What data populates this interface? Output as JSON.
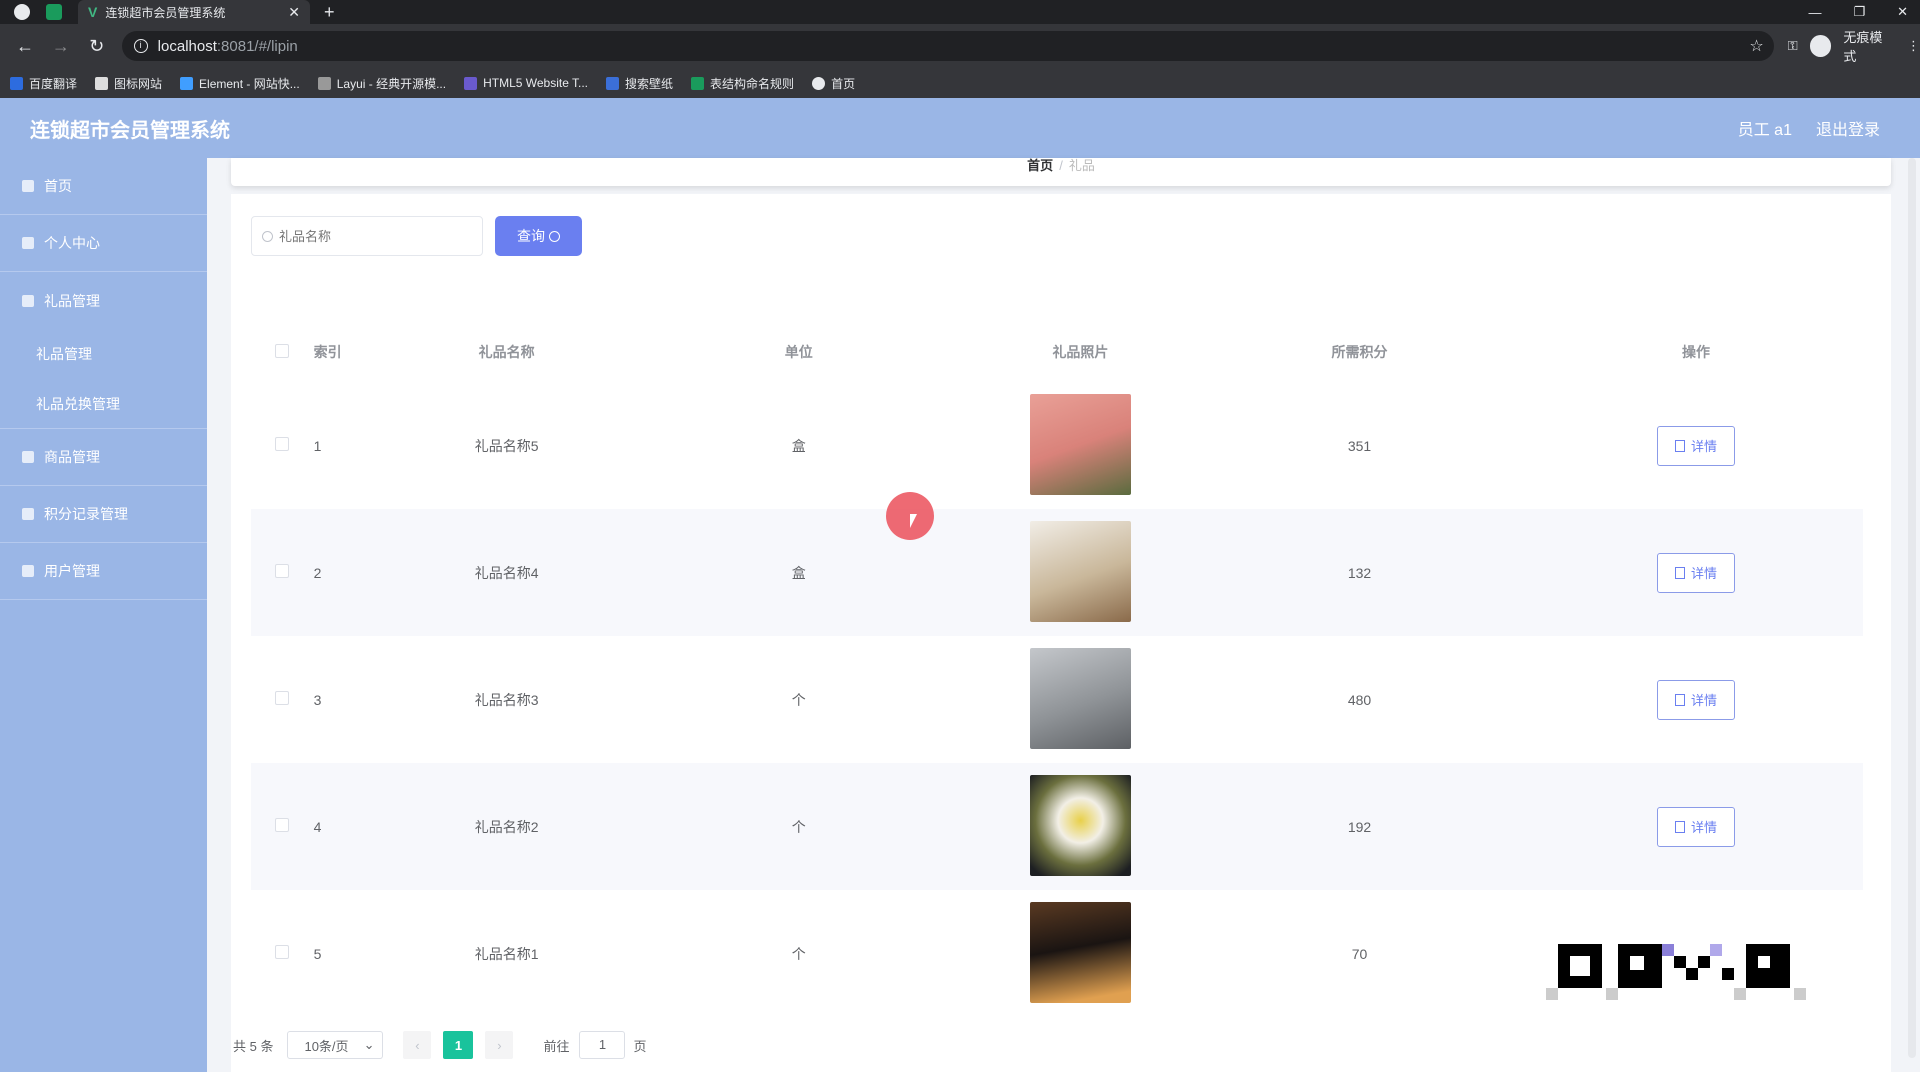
{
  "browser": {
    "tab_title": "连锁超市会员管理系统",
    "url_host": "localhost",
    "url_rest": ":8081/#/lipin",
    "incognito_label": "无痕模式",
    "bookmarks": [
      "百度翻译",
      "图标网站",
      "Element - 网站快...",
      "Layui - 经典开源模...",
      "HTML5 Website T...",
      "搜索壁纸",
      "表结构命名规则",
      "首页"
    ]
  },
  "header": {
    "title": "连锁超市会员管理系统",
    "user": "员工 a1",
    "logout": "退出登录"
  },
  "sidebar": {
    "items": [
      {
        "label": "首页"
      },
      {
        "label": "个人中心"
      },
      {
        "label": "礼品管理"
      },
      {
        "label": "礼品管理"
      },
      {
        "label": "礼品兑换管理"
      },
      {
        "label": "商品管理"
      },
      {
        "label": "积分记录管理"
      },
      {
        "label": "用户管理"
      }
    ]
  },
  "breadcrumb": {
    "home": "首页",
    "sep": "/",
    "current": "礼品"
  },
  "search": {
    "placeholder": "礼品名称",
    "button": "查询"
  },
  "table": {
    "headers": [
      "索引",
      "礼品名称",
      "单位",
      "礼品照片",
      "所需积分",
      "操作"
    ],
    "detail_label": "详情",
    "rows": [
      {
        "index": "1",
        "name": "礼品名称5",
        "unit": "盒",
        "points": "351",
        "photo_color": "#d9827a"
      },
      {
        "index": "2",
        "name": "礼品名称4",
        "unit": "盒",
        "points": "132",
        "photo_color": "#c9b79a"
      },
      {
        "index": "3",
        "name": "礼品名称3",
        "unit": "个",
        "points": "480",
        "photo_color": "#8f9397"
      },
      {
        "index": "4",
        "name": "礼品名称2",
        "unit": "个",
        "points": "192",
        "photo_color": "#6b6f3e"
      },
      {
        "index": "5",
        "name": "礼品名称1",
        "unit": "个",
        "points": "70",
        "photo_color": "#3a2a22"
      }
    ]
  },
  "pagination": {
    "total": "共 5 条",
    "page_size": "10条/页",
    "current_page": "1",
    "goto_label": "前往",
    "goto_value": "1",
    "page_suffix": "页"
  },
  "colors": {
    "header_bg": "#9ab6e6",
    "primary": "#6a7ff0",
    "page_active": "#19c39c"
  }
}
